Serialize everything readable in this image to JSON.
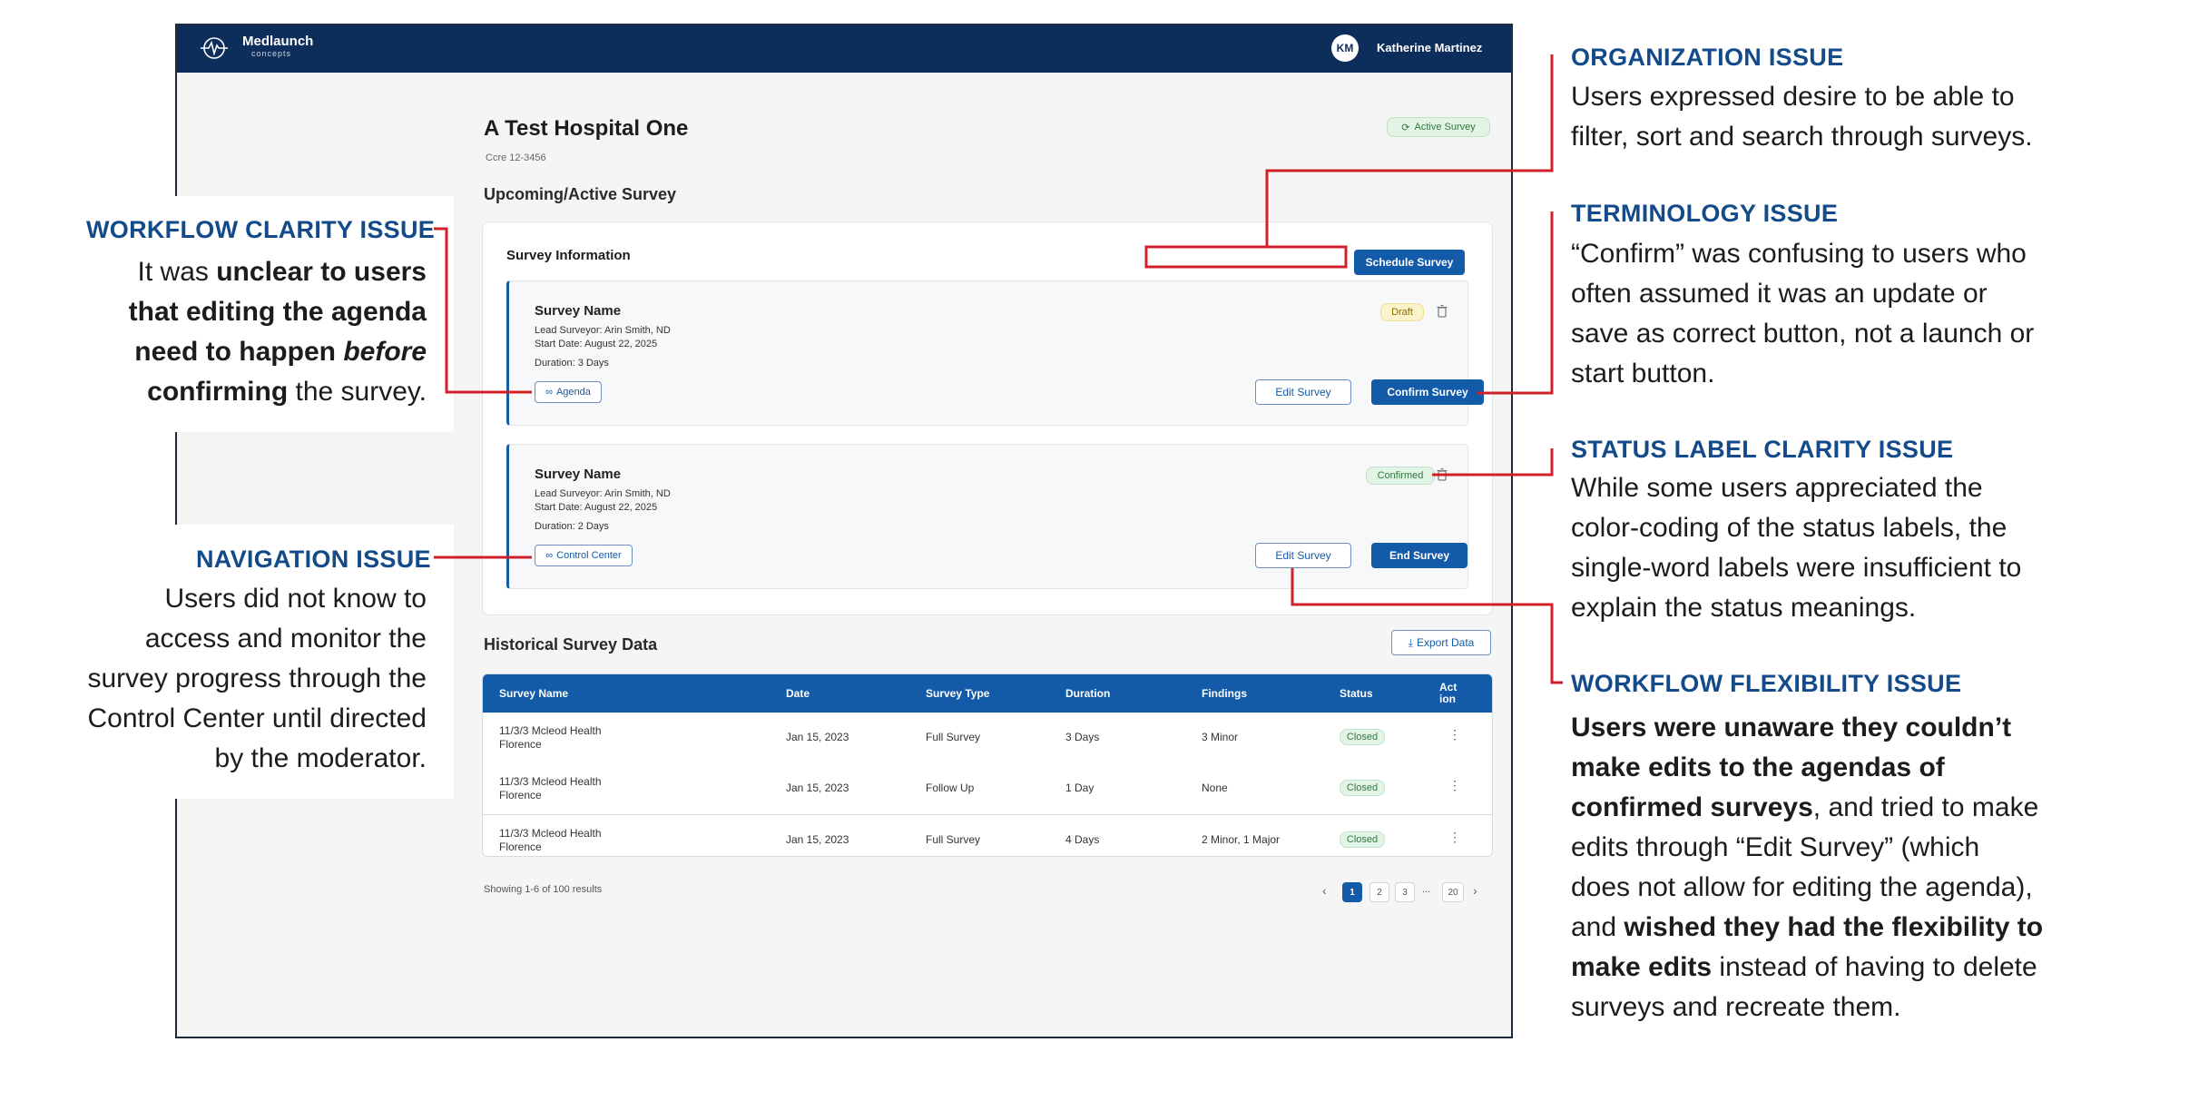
{
  "app": {
    "logo_text": "Medlaunch",
    "logo_sub": "concepts",
    "user_initials": "KM",
    "user_name": "Katherine Martinez"
  },
  "page": {
    "title": "A Test Hospital One",
    "code": "Ccre 12-3456",
    "active_badge": "Active Survey",
    "upcoming_heading": "Upcoming/Active Survey",
    "panel_title": "Survey Information",
    "schedule_button": "Schedule Survey"
  },
  "cards": [
    {
      "name": "Survey Name",
      "lead": "Lead Surveyor: Arin Smith, ND",
      "start": "Start Date: August 22, 2025",
      "duration": "Duration: 3 Days",
      "link_label": "Agenda",
      "status": "Draft",
      "secondary_button": "Edit Survey",
      "primary_button": "Confirm Survey"
    },
    {
      "name": "Survey Name",
      "lead": "Lead Surveyor: Arin Smith, ND",
      "start": "Start Date: August 22, 2025",
      "duration": "Duration: 2 Days",
      "link_label": "Control Center",
      "status": "Confirmed",
      "secondary_button": "Edit Survey",
      "primary_button": "End Survey"
    }
  ],
  "history": {
    "heading": "Historical Survey Data",
    "export_button": "Export Data",
    "columns": [
      "Survey Name",
      "Date",
      "Survey Type",
      "Duration",
      "Findings",
      "Status",
      "Act ion"
    ],
    "rows": [
      {
        "name1": "11/3/3 Mcleod Health",
        "name2": "Florence",
        "date": "Jan 15, 2023",
        "type": "Full Survey",
        "duration": "3 Days",
        "findings": "3 Minor",
        "status": "Closed"
      },
      {
        "name1": "11/3/3 Mcleod Health",
        "name2": "Florence",
        "date": "Jan 15, 2023",
        "type": "Follow Up",
        "duration": "1 Day",
        "findings": "None",
        "status": "Closed"
      },
      {
        "name1": "11/3/3 Mcleod Health",
        "name2": "Florence",
        "date": "Jan 15, 2023",
        "type": "Full Survey",
        "duration": "4 Days",
        "findings": "2 Minor, 1 Major",
        "status": "Closed"
      }
    ],
    "showing": "Showing 1-6 of 100 results",
    "pages": [
      "1",
      "2",
      "3",
      "...",
      "20"
    ]
  },
  "annotations": {
    "workflow_clarity": {
      "title": "WORKFLOW CLARITY ISSUE",
      "p1": "It was ",
      "b1": "unclear to users",
      "b2": "that editing the agenda",
      "b3": "need to happen ",
      "i1": "before",
      "b4": "confirming",
      "p2": " the survey."
    },
    "navigation": {
      "title": "NAVIGATION ISSUE",
      "lines": [
        "Users did not know to",
        "access and monitor the",
        "survey progress through the",
        "Control Center until directed",
        "by the moderator."
      ]
    },
    "organization": {
      "title": "ORGANIZATION ISSUE",
      "lines": [
        "Users expressed desire to be able to",
        "filter, sort and search through surveys."
      ]
    },
    "terminology": {
      "title": "TERMINOLOGY ISSUE",
      "lines": [
        "“Confirm” was confusing to users who",
        "often assumed it was an update or",
        "save as correct button, not a launch or",
        "start button."
      ]
    },
    "status_label": {
      "title": "STATUS LABEL CLARITY ISSUE",
      "lines": [
        "While some users appreciated the",
        "color-coding of the status labels, the",
        "single-word labels were insufficient to",
        "explain the status meanings."
      ]
    },
    "workflow_flex": {
      "title": "WORKFLOW FLEXIBILITY ISSUE",
      "b1": "Users were unaware they couldn’t",
      "b2": "make edits to the agendas of",
      "b3": "confirmed surveys",
      "p1": ", and tried to make",
      "p2": "edits through “Edit Survey” (which",
      "p3": "does not allow for editing the agenda),",
      "p4": "and ",
      "b4": "wished they had the flexibility to",
      "b5": "make edits",
      "p5": " instead of having to delete",
      "p6": "surveys and recreate them."
    }
  },
  "colors": {
    "navy": "#0d2d5a",
    "accent_blue": "#135aa8",
    "annotation_blue": "#134a8a",
    "callout_red": "#d0202a",
    "closed_green": "#2e7a3d"
  }
}
